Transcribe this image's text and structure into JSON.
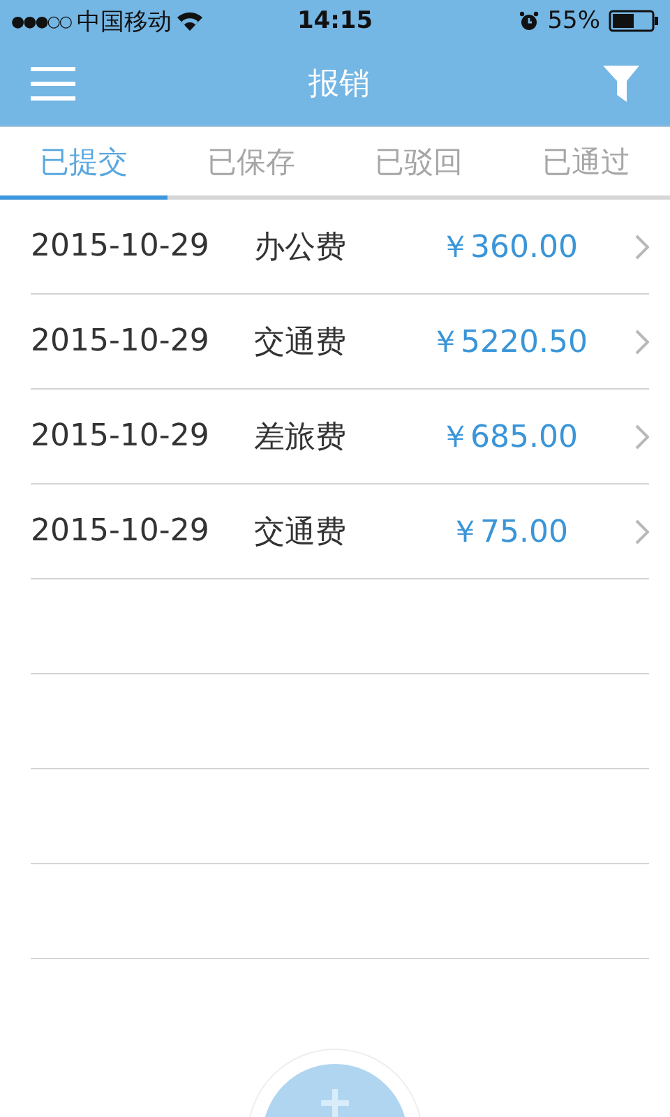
{
  "status_bar": {
    "signal_dots": "●●●○○",
    "carrier": "中国移动",
    "time": "14:15",
    "battery": "55%"
  },
  "header": {
    "title": "报销"
  },
  "tabs": [
    {
      "label": "已提交",
      "selected": true
    },
    {
      "label": "已保存",
      "selected": false
    },
    {
      "label": "已驳回",
      "selected": false
    },
    {
      "label": "已通过",
      "selected": false
    }
  ],
  "rows": [
    {
      "date": "2015-10-29",
      "category": "办公费",
      "amount": "￥360.00"
    },
    {
      "date": "2015-10-29",
      "category": "交通费",
      "amount": "￥5220.50"
    },
    {
      "date": "2015-10-29",
      "category": "差旅费",
      "amount": "￥685.00"
    },
    {
      "date": "2015-10-29",
      "category": "交通费",
      "amount": "￥75.00"
    }
  ]
}
